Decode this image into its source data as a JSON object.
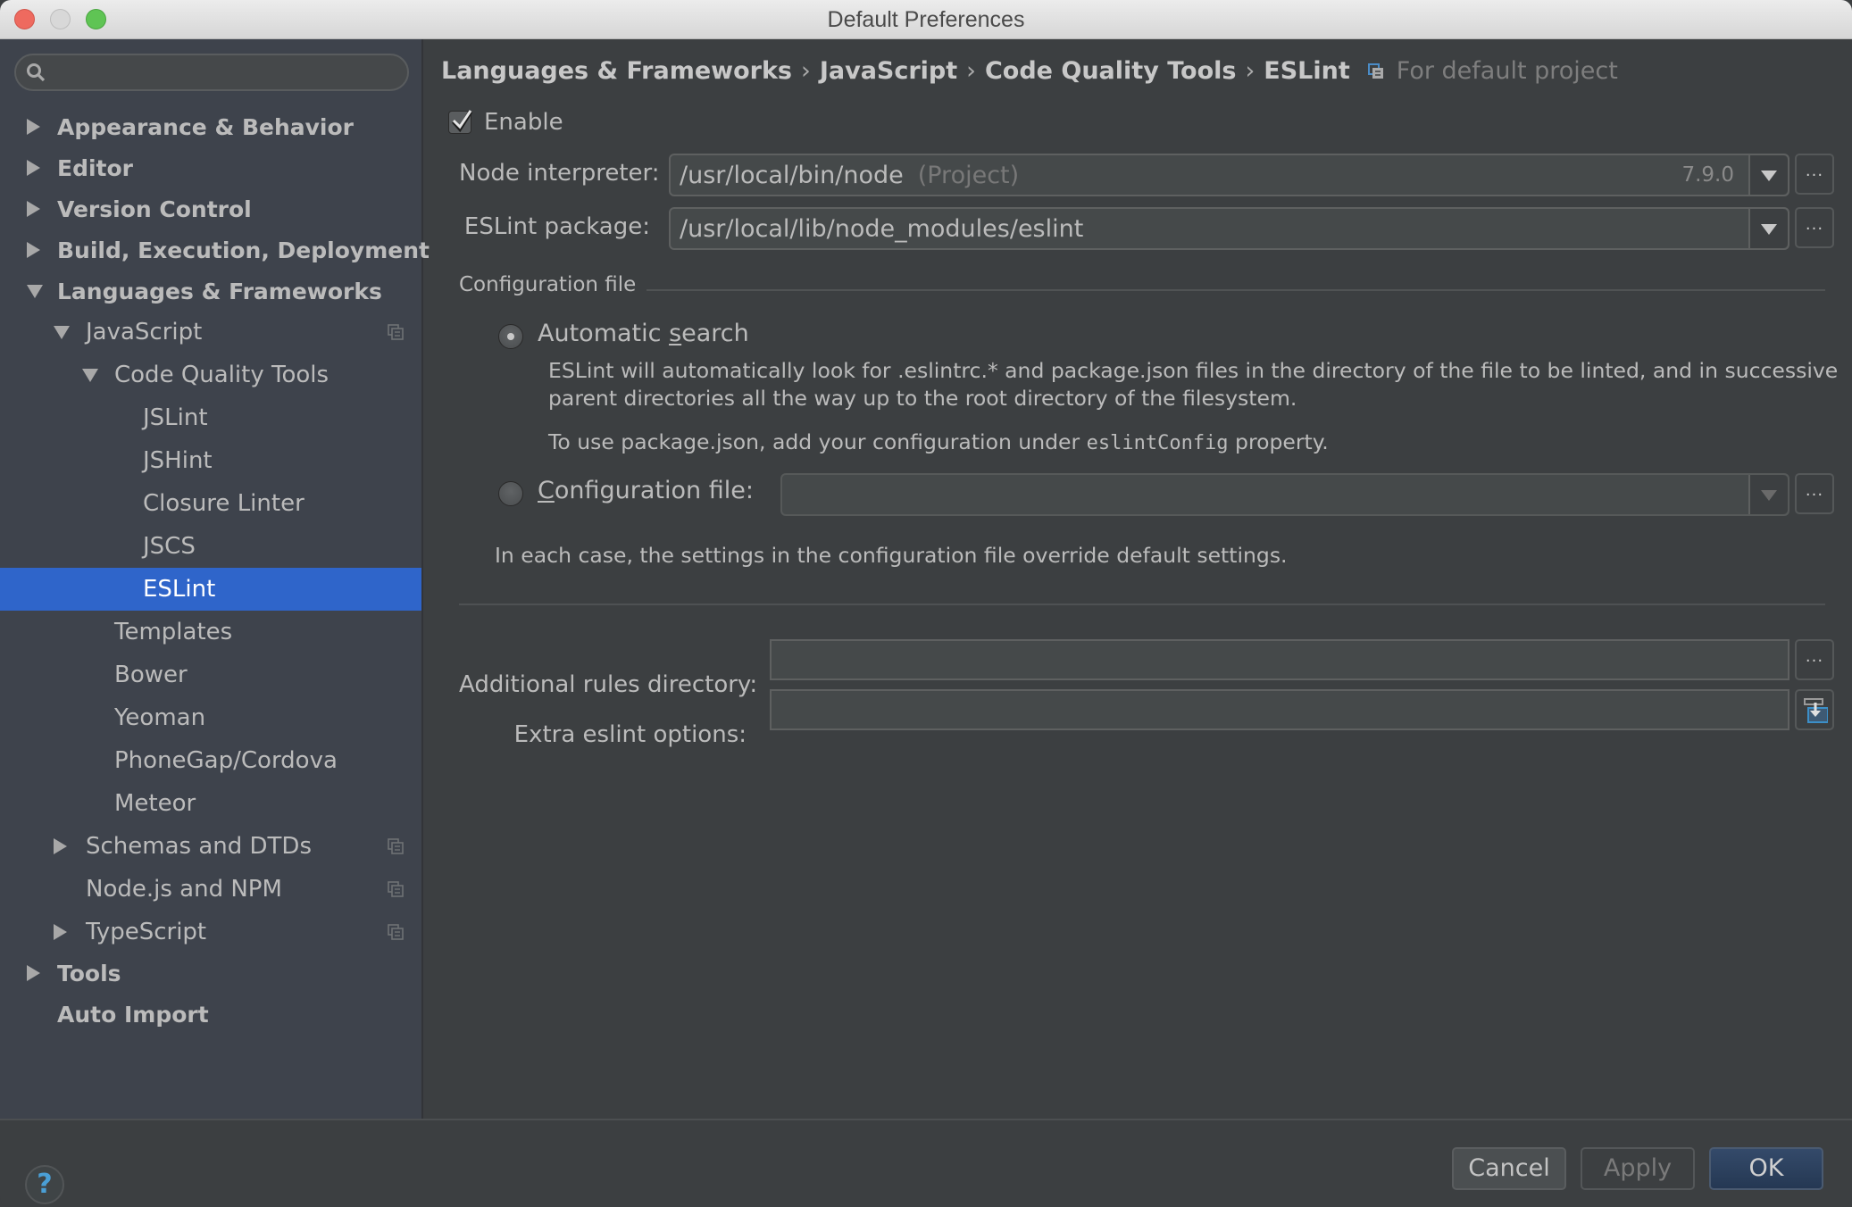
{
  "window": {
    "title": "Default Preferences",
    "controls": [
      "close",
      "minimize",
      "maximize"
    ]
  },
  "sidebar": {
    "search": {
      "value": "",
      "placeholder": ""
    },
    "tree": [
      {
        "label": "Appearance & Behavior",
        "level": 0,
        "expander": "collapsed",
        "bold": true
      },
      {
        "label": "Editor",
        "level": 0,
        "expander": "collapsed",
        "bold": true
      },
      {
        "label": "Version Control",
        "level": 0,
        "expander": "collapsed",
        "bold": true
      },
      {
        "label": "Build, Execution, Deployment",
        "level": 0,
        "expander": "collapsed",
        "bold": true
      },
      {
        "label": "Languages & Frameworks",
        "level": 0,
        "expander": "expanded",
        "bold": true
      },
      {
        "label": "JavaScript",
        "level": 1,
        "expander": "expanded",
        "project_icon": true
      },
      {
        "label": "Code Quality Tools",
        "level": 2,
        "expander": "expanded"
      },
      {
        "label": "JSLint",
        "level": 3
      },
      {
        "label": "JSHint",
        "level": 3
      },
      {
        "label": "Closure Linter",
        "level": 3
      },
      {
        "label": "JSCS",
        "level": 3
      },
      {
        "label": "ESLint",
        "level": 3,
        "selected": true
      },
      {
        "label": "Templates",
        "level": 2
      },
      {
        "label": "Bower",
        "level": 2
      },
      {
        "label": "Yeoman",
        "level": 2
      },
      {
        "label": "PhoneGap/Cordova",
        "level": 2
      },
      {
        "label": "Meteor",
        "level": 2
      },
      {
        "label": "Schemas and DTDs",
        "level": 1,
        "expander": "collapsed",
        "project_icon": true
      },
      {
        "label": "Node.js and NPM",
        "level": 1,
        "project_icon": true
      },
      {
        "label": "TypeScript",
        "level": 1,
        "expander": "collapsed",
        "project_icon": true
      },
      {
        "label": "Tools",
        "level": 0,
        "expander": "collapsed",
        "bold": true
      },
      {
        "label": "Auto Import",
        "level": 0,
        "bold": true
      }
    ]
  },
  "main": {
    "breadcrumb": {
      "items": [
        "Languages & Frameworks",
        "JavaScript",
        "Code Quality Tools",
        "ESLint"
      ],
      "separator": "›",
      "scope": "For default project"
    },
    "enable": {
      "label": "Enable",
      "checked": true
    },
    "node_interpreter": {
      "label": "Node interpreter:",
      "value": "/usr/local/bin/node",
      "hint": "(Project)",
      "version": "7.9.0",
      "browse_label": "..."
    },
    "eslint_package": {
      "label": "ESLint package:",
      "value": "/usr/local/lib/node_modules/eslint",
      "browse_label": "..."
    },
    "config_section": {
      "title": "Configuration file",
      "automatic": {
        "label_prefix": "Automatic ",
        "label_mnemonic": "s",
        "label_suffix": "earch",
        "selected": true,
        "desc_line1": "ESLint will automatically look for .eslintrc.* and package.json files in the directory of the file to be linted, and in successive",
        "desc_line2": "parent directories all the way up to the root directory of the filesystem.",
        "desc_line3_prefix": "To use package.json, add your configuration under ",
        "desc_line3_code": "eslintConfig",
        "desc_line3_suffix": " property."
      },
      "manual": {
        "label_mnemonic": "C",
        "label_suffix": "onfiguration file:",
        "selected": false,
        "value": "",
        "browse_label": "..."
      },
      "note": "In each case, the settings in the configuration file override default settings."
    },
    "additional_rules": {
      "label": "Additional rules directory:",
      "value": "",
      "browse_label": "..."
    },
    "extra_options": {
      "label": "Extra eslint options:",
      "value": ""
    }
  },
  "footer": {
    "help_label": "?",
    "cancel_label": "Cancel",
    "apply_label": "Apply",
    "ok_label": "OK"
  },
  "colors": {
    "selection": "#2f65ca",
    "sidebar_bg": "#3e434c",
    "panel_bg": "#3c3f41",
    "ok_button": "#2d4363"
  }
}
